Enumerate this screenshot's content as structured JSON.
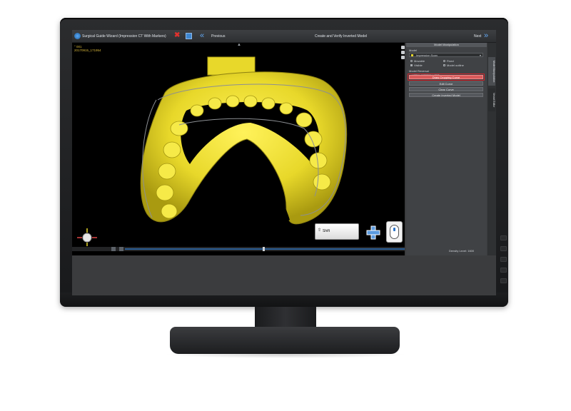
{
  "window": {
    "app_title": "Surgical Guide Wizard (Impression CT With Markers)",
    "prev_label": "Previous",
    "center_title": "Create and Verify Inverted Model",
    "next_label": "Next"
  },
  "viewport": {
    "info_line1": "° 001",
    "info_line2": "20170915_171954",
    "shift_key_label": "Shift",
    "hint_plus": "+",
    "handle": "▲"
  },
  "panel": {
    "header": "Model Manipulation",
    "model_section_label": "Model",
    "model_selected": "Impression Scan",
    "opt_movable": "Movable",
    "opt_visible": "Visible",
    "opt_fixed": "Fixed",
    "opt_model_outline": "Model outline",
    "model_reversal_label": "Model Reversal",
    "sub_label": "Draw Cropping Curve",
    "btn_draw": "Draw Cropping Curve",
    "btn_edit": "Edit Curve",
    "btn_clear": "Clear Curve",
    "btn_create": "Create Inverted Model",
    "tabs": [
      "Model Manipulation",
      "Vessel Editor"
    ],
    "density_level": "Density Level: 1600"
  },
  "colors": {
    "model_yellow": "#e8d82a",
    "accent_blue": "#62a6ef",
    "highlight_red": "#d0232a"
  }
}
